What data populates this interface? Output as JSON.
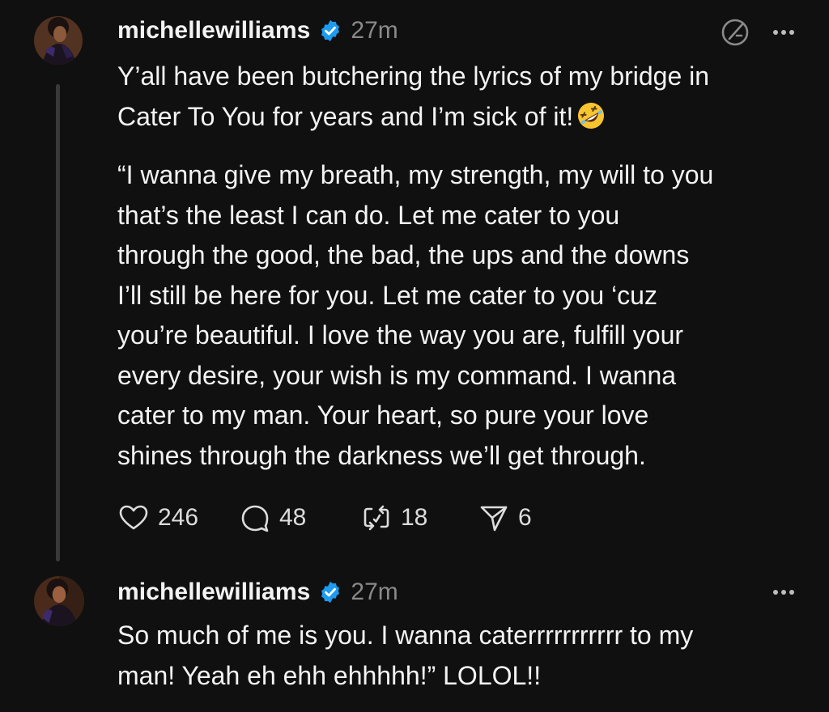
{
  "posts": [
    {
      "username": "michellewilliams",
      "time": "27m",
      "text_line1": "Y’all have been butchering the lyrics of my bridge in",
      "text_line2": "Cater To You for years and I’m sick of it!",
      "emoji": "rolling-on-floor-laughing",
      "text_para2": "“I wanna give my breath, my strength, my will to you\nthat’s the least I can do. Let me cater to you\nthrough the good, the bad, the ups and the downs\nI’ll still be here for you. Let me cater to you ‘cuz\nyou’re beautiful. I love the way you are, fulfill your\nevery desire, your wish is my command. I wanna\ncater to my man. Your heart, so pure your love\nshines through the darkness we’ll get through.",
      "likes": "246",
      "replies": "48",
      "reposts": "18",
      "shares": "6"
    },
    {
      "username": "michellewilliams",
      "time": "27m",
      "text": "So much of me is you. I wanna caterrrrrrrrrrr to my\nman! Yeah eh ehh ehhhhh!” LOLOL!!"
    }
  ],
  "icons": {
    "verified": "verified-badge-icon",
    "translate": "translate-icon",
    "more": "more-dots-icon",
    "like": "heart-icon",
    "reply": "comment-bubble-icon",
    "repost": "repost-icon",
    "share": "send-icon"
  },
  "colors": {
    "background": "#101010",
    "text": "#f3f3f3",
    "muted": "#8a8a8a",
    "verified": "#1d9bf0",
    "thread_line": "#3a3a3a"
  }
}
